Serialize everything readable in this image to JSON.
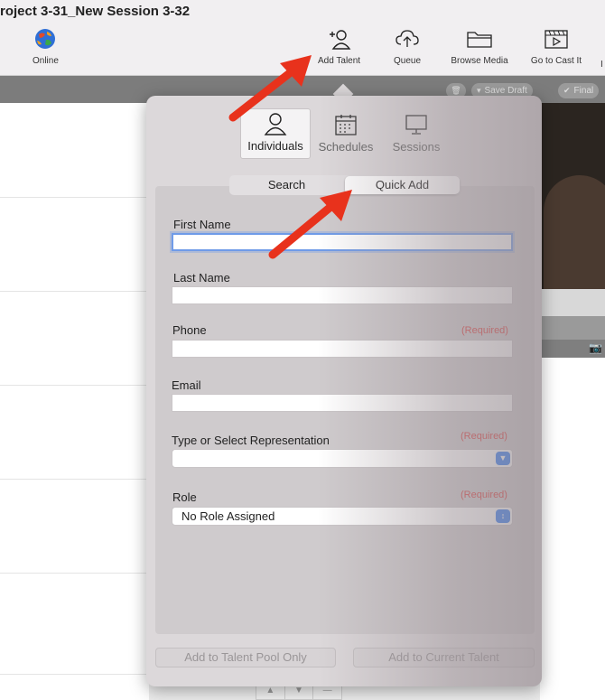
{
  "window": {
    "title": "roject 3-31_New Session 3-32"
  },
  "toolbar": {
    "online": {
      "label": "Online",
      "icon": "globe-icon"
    },
    "add_talent": {
      "label": "Add Talent",
      "icon": "add-person-icon"
    },
    "queue": {
      "label": "Queue",
      "icon": "cloud-upload-icon"
    },
    "browse_media": {
      "label": "Browse Media",
      "icon": "folder-icon"
    },
    "go_to_cast_it": {
      "label": "Go to Cast It",
      "icon": "clapper-icon"
    },
    "overflow_label": "I"
  },
  "action_bar": {
    "save_draft": "Save Draft",
    "final": "Final"
  },
  "popover": {
    "tabs": [
      {
        "label": "Individuals",
        "icon": "person-icon",
        "active": true
      },
      {
        "label": "Schedules",
        "icon": "calendar-icon",
        "active": false
      },
      {
        "label": "Sessions",
        "icon": "monitor-icon",
        "active": false
      }
    ],
    "segment": {
      "search": "Search",
      "quick_add": "Quick Add",
      "selected": "Quick Add"
    },
    "form": {
      "first_name": {
        "label": "First Name",
        "value": ""
      },
      "last_name": {
        "label": "Last Name",
        "value": ""
      },
      "phone": {
        "label": "Phone",
        "required": "(Required)",
        "value": ""
      },
      "email": {
        "label": "Email",
        "value": ""
      },
      "representation": {
        "label": "Type or Select Representation",
        "required": "(Required)",
        "value": ""
      },
      "role": {
        "label": "Role",
        "required": "(Required)",
        "value": "No Role Assigned"
      }
    },
    "buttons": {
      "add_to_pool": "Add to Talent Pool Only",
      "add_to_current": "Add to Current Talent"
    }
  },
  "bottom_controls": {
    "up": "▲",
    "down": "▼",
    "minus": "—"
  },
  "colors": {
    "annotation_arrow": "#e8321c",
    "focus_ring": "#6f9be8",
    "required": "#e03b3b",
    "select_accent": "#2f7cf6"
  }
}
